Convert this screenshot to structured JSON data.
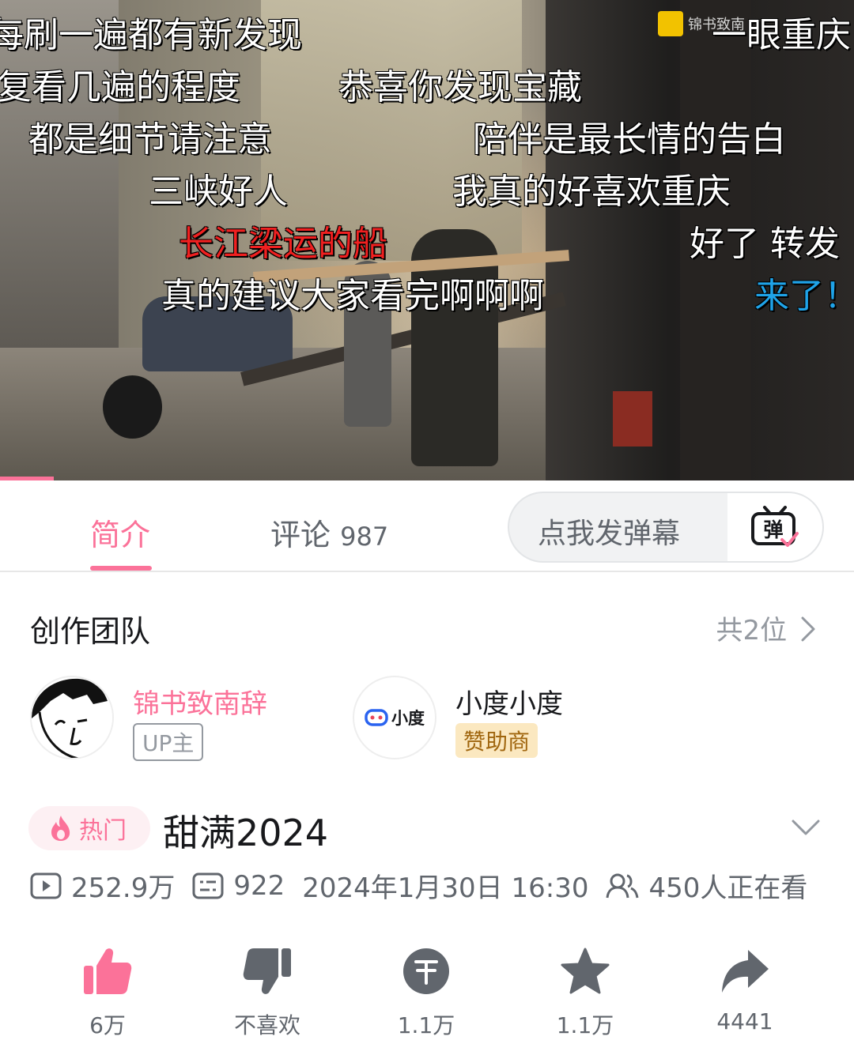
{
  "video": {
    "danmaku": [
      {
        "text": "每刷一遍都有新发现",
        "color": "white"
      },
      {
        "text": "复看几遍的程度",
        "color": "white"
      },
      {
        "text": "恭喜你发现宝藏",
        "color": "white"
      },
      {
        "text": "都是细节请注意",
        "color": "white"
      },
      {
        "text": "陪伴是最长情的告白",
        "color": "white"
      },
      {
        "text": "三峡好人",
        "color": "white"
      },
      {
        "text": "我真的好喜欢重庆",
        "color": "white"
      },
      {
        "text": "长江梁运的船",
        "color": "red"
      },
      {
        "text": "好了  转发",
        "color": "white"
      },
      {
        "text": "真的建议大家看完啊啊啊",
        "color": "white"
      },
      {
        "text": "来了！",
        "color": "blue"
      },
      {
        "text": "一眼重庆",
        "color": "white"
      }
    ],
    "watermark": "锦书致南",
    "progress_fraction": 0.063
  },
  "tabs": {
    "intro": "简介",
    "comments_label": "评论",
    "comments_count": "987",
    "danmaku_placeholder": "点我发弹幕",
    "danmaku_button_glyph": "弹"
  },
  "team": {
    "title": "创作团队",
    "count": "共2位",
    "members": [
      {
        "name": "锦书致南辞",
        "badge": "UP主"
      },
      {
        "name": "小度小度",
        "badge": "赞助商",
        "logo_text": "小度"
      }
    ]
  },
  "video_info": {
    "hot_label": "热门",
    "title": "甜满2024",
    "views": "252.9万",
    "danmaku_count": "922",
    "datetime": "2024年1月30日 16:30",
    "watching": "450人正在看"
  },
  "actions": {
    "like": "6万",
    "dislike": "不喜欢",
    "coin": "1.1万",
    "favorite": "1.1万",
    "share": "4441"
  },
  "colors": {
    "accent": "#fb7299",
    "sponsor_badge_bg": "#fbe8c0",
    "sponsor_badge_text": "#a0660f"
  }
}
